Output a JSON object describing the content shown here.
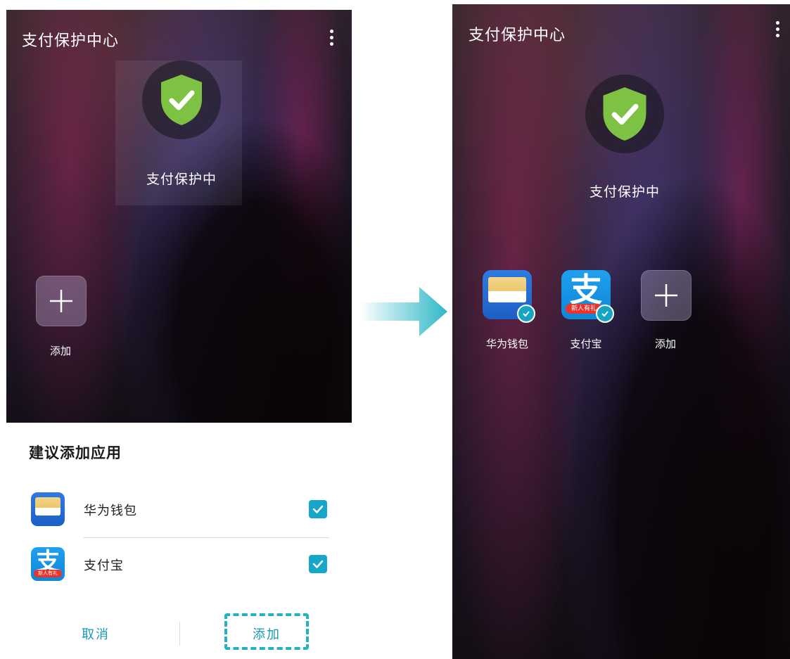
{
  "left_screen": {
    "title": "支付保护中心",
    "status": "支付保护中",
    "add_label": "添加"
  },
  "sheet": {
    "title": "建议添加应用",
    "apps": [
      {
        "name": "华为钱包",
        "checked": true
      },
      {
        "name": "支付宝",
        "checked": true
      }
    ],
    "cancel_label": "取消",
    "add_label": "添加"
  },
  "right_screen": {
    "title": "支付保护中心",
    "status": "支付保护中",
    "apps": [
      {
        "label": "华为钱包",
        "icon": "huawei-wallet-icon"
      },
      {
        "label": "支付宝",
        "icon": "alipay-icon"
      },
      {
        "label": "添加",
        "icon": "plus-icon"
      }
    ]
  },
  "alipay_ribbon_text": "新人有礼",
  "colors": {
    "shield_green": "#7dc242",
    "accent_teal": "#16a6c9",
    "dashed_highlight": "#1fb3c4",
    "arrow": "#2fb8c8"
  }
}
